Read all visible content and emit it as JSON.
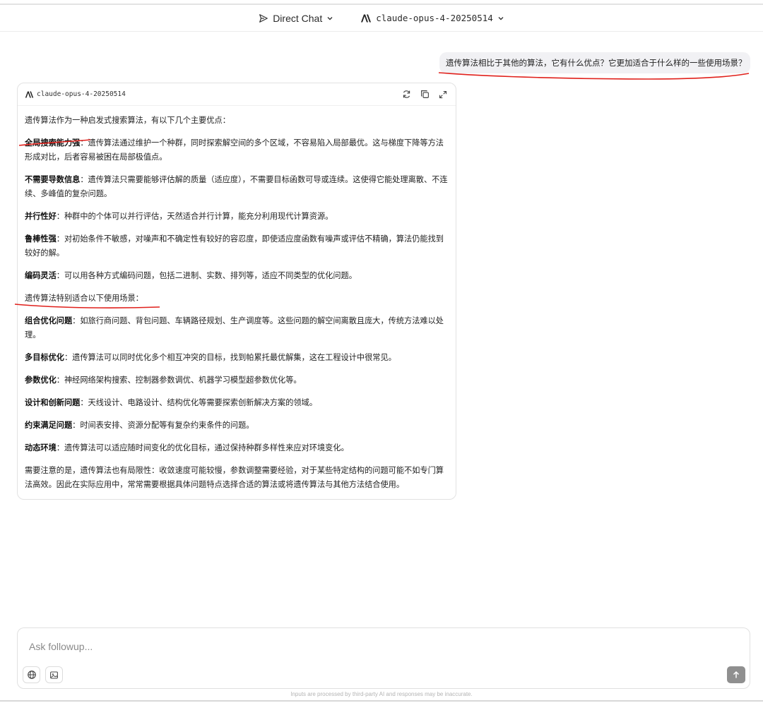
{
  "header": {
    "mode_label": "Direct Chat",
    "model_label": "claude-opus-4-20250514"
  },
  "user_message": "遗传算法相比于其他的算法，它有什么优点？它更加适合于什么样的一些使用场景？",
  "answer": {
    "model": "claude-opus-4-20250514",
    "intro": "遗传算法作为一种启发式搜索算法，有以下几个主要优点：",
    "advantages": [
      {
        "title": "全局搜索能力强",
        "text": "：遗传算法通过维护一个种群，同时探索解空间的多个区域，不容易陷入局部最优。这与梯度下降等方法形成对比，后者容易被困在局部极值点。"
      },
      {
        "title": "不需要导数信息",
        "text": "：遗传算法只需要能够评估解的质量（适应度），不需要目标函数可导或连续。这使得它能处理离散、不连续、多峰值的复杂问题。"
      },
      {
        "title": "并行性好",
        "text": "：种群中的个体可以并行评估，天然适合并行计算，能充分利用现代计算资源。"
      },
      {
        "title": "鲁棒性强",
        "text": "：对初始条件不敏感，对噪声和不确定性有较好的容忍度，即使适应度函数有噪声或评估不精确，算法仍能找到较好的解。"
      },
      {
        "title": "编码灵活",
        "text": "：可以用各种方式编码问题，包括二进制、实数、排列等，适应不同类型的优化问题。"
      }
    ],
    "scenarios_intro": "遗传算法特别适合以下使用场景：",
    "scenarios": [
      {
        "title": "组合优化问题",
        "text": "：如旅行商问题、背包问题、车辆路径规划、生产调度等。这些问题的解空间离散且庞大，传统方法难以处理。"
      },
      {
        "title": "多目标优化",
        "text": "：遗传算法可以同时优化多个相互冲突的目标，找到帕累托最优解集，这在工程设计中很常见。"
      },
      {
        "title": "参数优化",
        "text": "：神经网络架构搜索、控制器参数调优、机器学习模型超参数优化等。"
      },
      {
        "title": "设计和创新问题",
        "text": "：天线设计、电路设计、结构优化等需要探索创新解决方案的领域。"
      },
      {
        "title": "约束满足问题",
        "text": "：时间表安排、资源分配等有复杂约束条件的问题。"
      },
      {
        "title": "动态环境",
        "text": "：遗传算法可以适应随时间变化的优化目标，通过保持种群多样性来应对环境变化。"
      }
    ],
    "conclusion": "需要注意的是，遗传算法也有局限性：收敛速度可能较慢，参数调整需要经验，对于某些特定结构的问题可能不如专门算法高效。因此在实际应用中，常常需要根据具体问题特点选择合适的算法或将遗传算法与其他方法结合使用。"
  },
  "compose": {
    "placeholder": "Ask followup..."
  },
  "footer_note": "Inputs are processed by third-party AI and responses may be inaccurate.",
  "colors": {
    "annotation_red": "#e0201b",
    "send_button": "#8f8f8f",
    "user_bubble_bg": "#f1f1f4"
  }
}
